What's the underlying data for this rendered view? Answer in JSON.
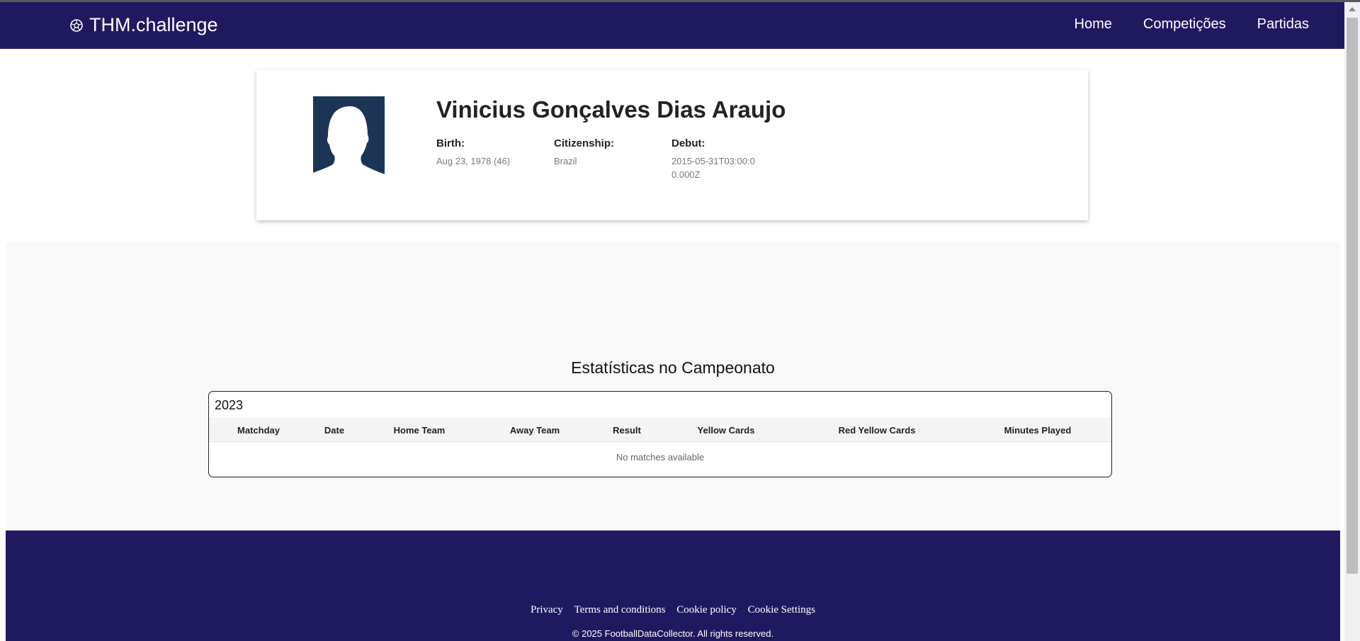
{
  "header": {
    "brand": "THM.challenge",
    "brand_icon": "soccer-ball-icon",
    "nav": [
      "Home",
      "Competições",
      "Partidas"
    ]
  },
  "player": {
    "name": "Vinicius Gonçalves Dias Araujo",
    "avatar_icon": "person-silhouette-icon",
    "birth_label": "Birth:",
    "birth_value": "Aug 23, 1978 (46)",
    "citizenship_label": "Citizenship:",
    "citizenship_value": "Brazil",
    "debut_label": "Debut:",
    "debut_value": "2015-05-31T03:00:00.000Z"
  },
  "stats": {
    "title": "Estatísticas no Campeonato",
    "year": "2023",
    "columns": [
      "Matchday",
      "Date",
      "Home Team",
      "Away Team",
      "Result",
      "Yellow Cards",
      "Red Yellow Cards",
      "Minutes Played"
    ],
    "empty_message": "No matches available"
  },
  "footer": {
    "links": [
      "Privacy",
      "Terms and conditions",
      "Cookie policy",
      "Cookie Settings"
    ],
    "copyright": "© 2025 FootballDataCollector. All rights reserved."
  },
  "colors": {
    "navy": "#1f1a60",
    "avatar": "#1c3557"
  }
}
